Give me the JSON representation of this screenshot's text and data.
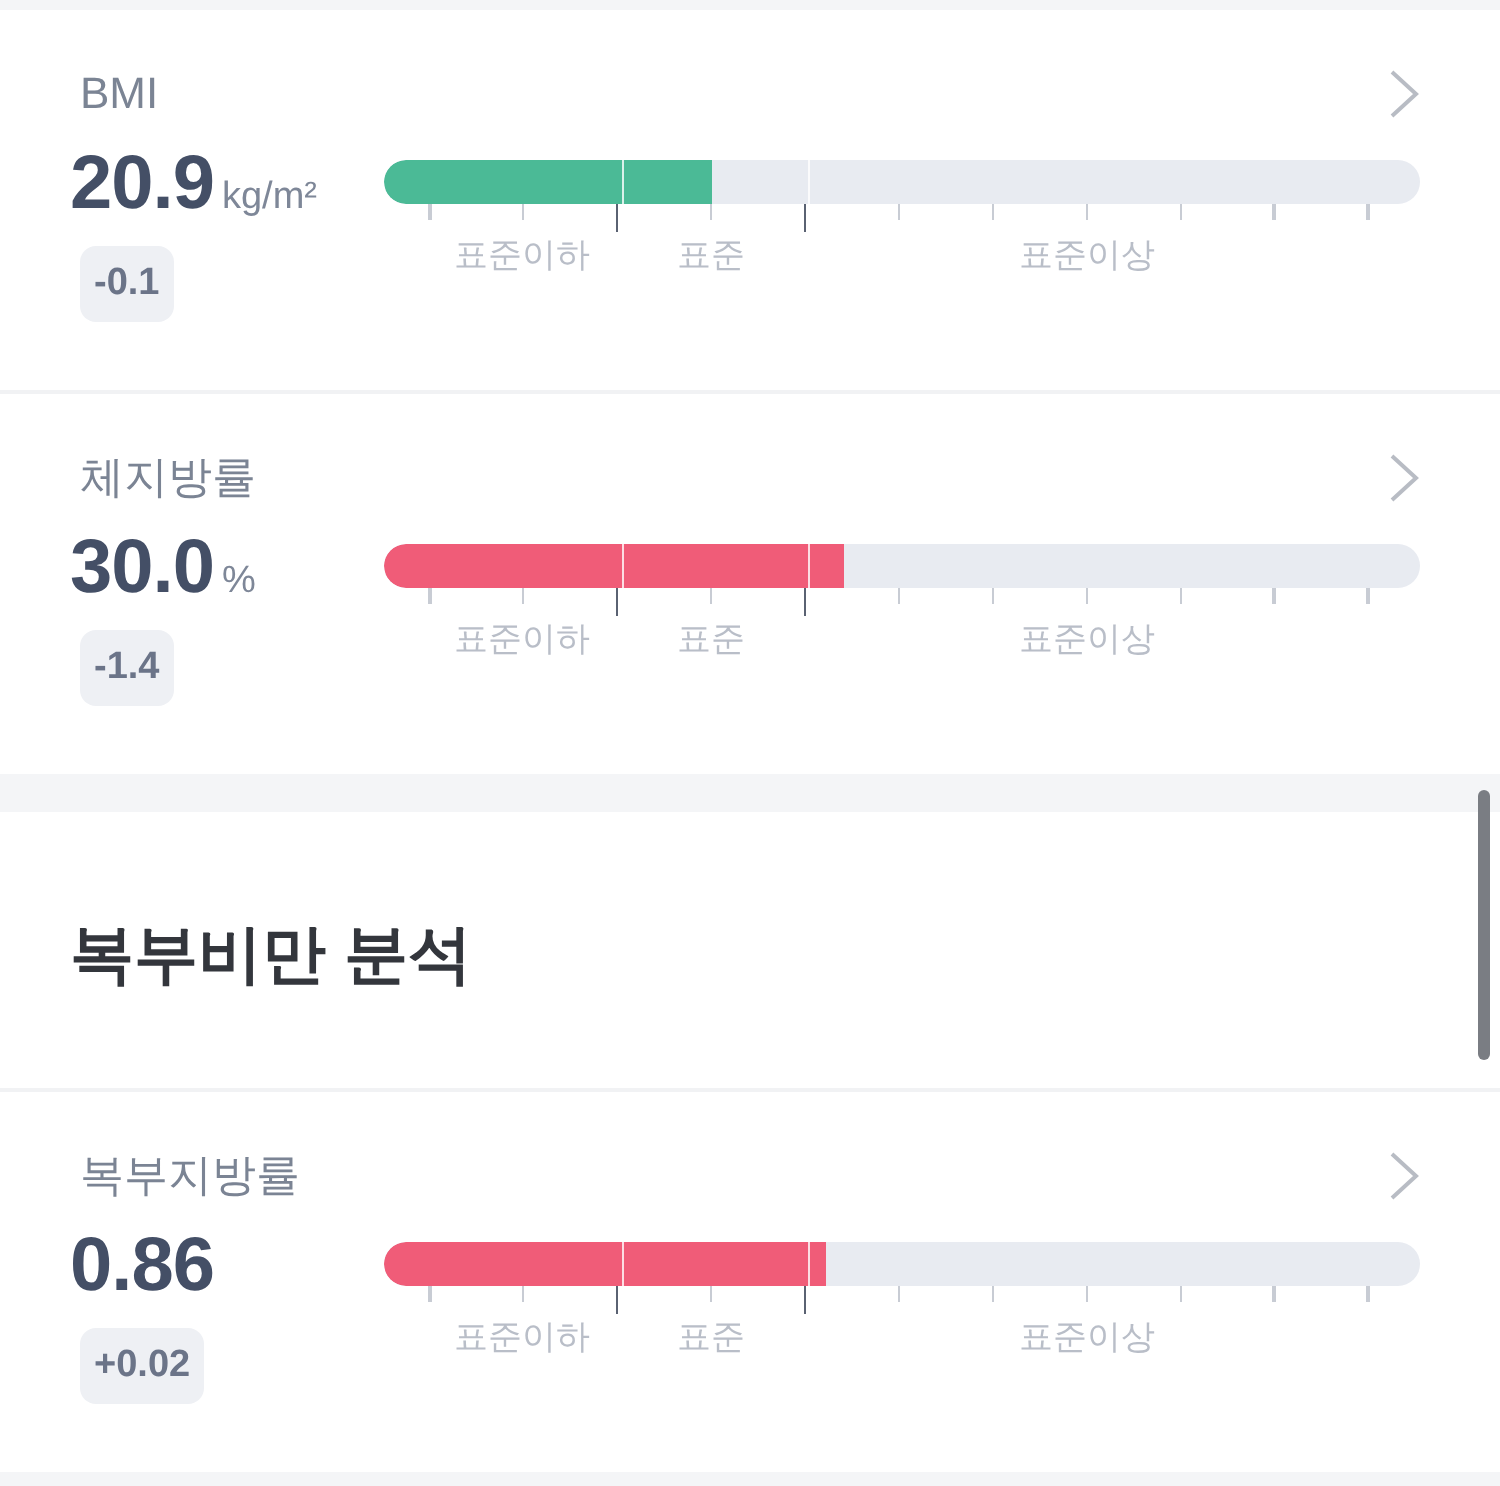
{
  "metrics": [
    {
      "label": "BMI",
      "value": "20.9",
      "unit": "kg/m²",
      "change": "-0.1",
      "level": 0.316,
      "color": "#4bba96",
      "scale_labels": [
        "표준이하",
        "표준",
        "표준이상"
      ]
    },
    {
      "label": "체지방률",
      "value": "30.0",
      "unit": "%",
      "change": "-1.4",
      "level": 0.444,
      "color": "#f05c78",
      "scale_labels": [
        "표준이하",
        "표준",
        "표준이상"
      ]
    }
  ],
  "section": {
    "title": "복부비만 분석",
    "metrics": [
      {
        "label": "복부지방률",
        "value": "0.86",
        "change": "+0.02",
        "level": 0.427,
        "color": "#f05c78",
        "scale_labels": [
          "표준이하",
          "표준",
          "표준이상"
        ]
      }
    ]
  }
}
